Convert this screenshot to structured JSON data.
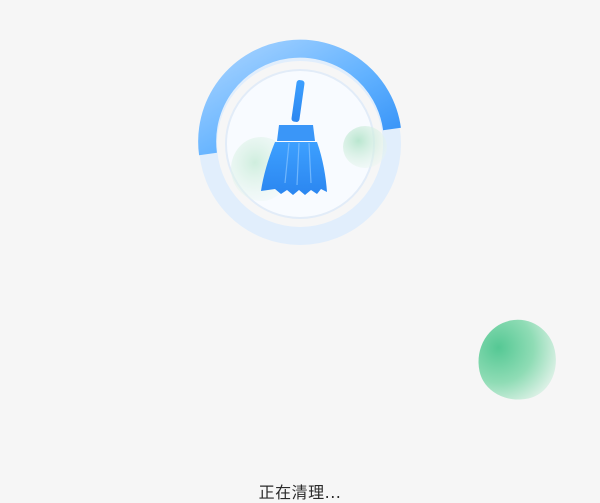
{
  "status": {
    "label": "正在清理..."
  },
  "cleaner": {
    "icon": "broom-icon",
    "accent_color": "#3d9bff",
    "ring_color": "#dbeafb",
    "bubble_color": "#55c894"
  }
}
